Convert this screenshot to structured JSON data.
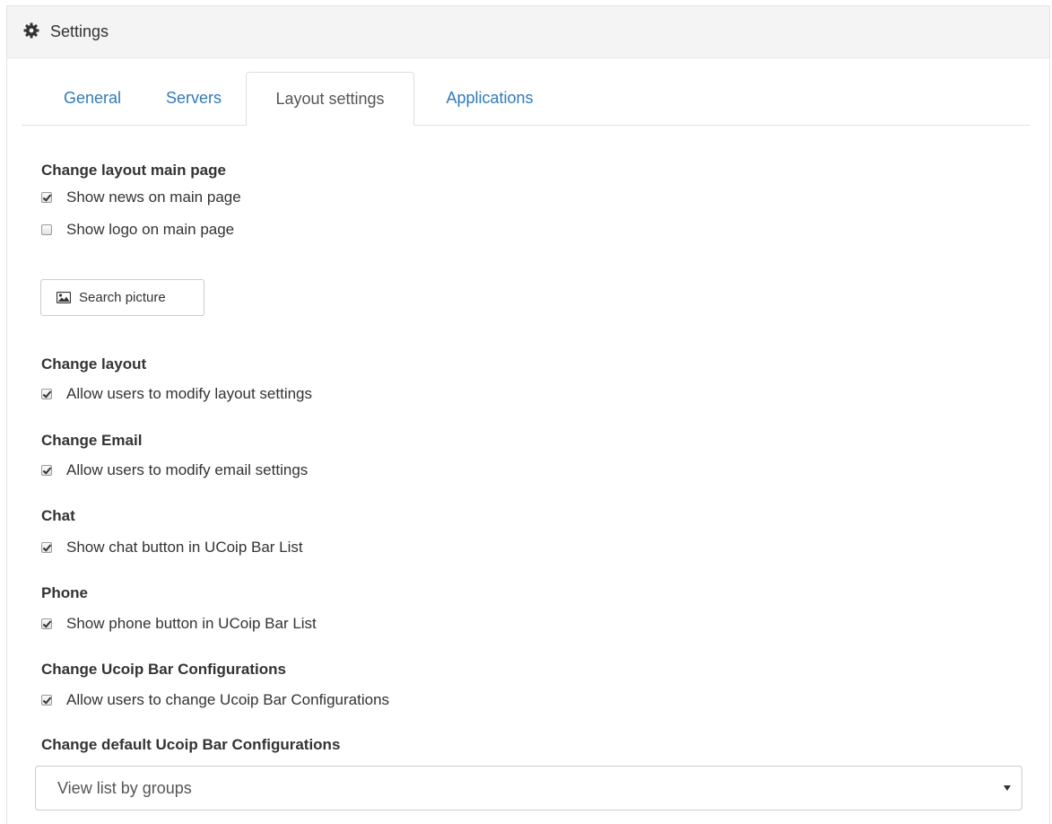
{
  "header": {
    "title": "Settings",
    "icon": "gear-icon"
  },
  "tabs": [
    {
      "label": "General",
      "active": false
    },
    {
      "label": "Servers",
      "active": false
    },
    {
      "label": "Layout settings",
      "active": true
    },
    {
      "label": "Applications",
      "active": false
    }
  ],
  "sections": {
    "main_page": {
      "title": "Change layout main page",
      "options": [
        {
          "label": "Show news on main page",
          "checked": true
        },
        {
          "label": "Show logo on main page",
          "checked": false
        }
      ],
      "button_label": "Search picture",
      "button_icon": "picture-icon"
    },
    "layout": {
      "title": "Change layout",
      "option": {
        "label": "Allow users to modify layout settings",
        "checked": true
      }
    },
    "email": {
      "title": "Change Email",
      "option": {
        "label": "Allow users to modify email settings",
        "checked": true
      }
    },
    "chat": {
      "title": "Chat",
      "option": {
        "label": "Show chat button in UCoip Bar List",
        "checked": true
      }
    },
    "phone": {
      "title": "Phone",
      "option": {
        "label": "Show phone button in UCoip Bar List",
        "checked": true
      }
    },
    "ucoip_config": {
      "title": "Change Ucoip Bar Configurations",
      "option": {
        "label": "Allow users to change Ucoip Bar Configurations",
        "checked": true
      }
    },
    "default_config": {
      "title": "Change default Ucoip Bar Configurations",
      "select_value": "View list by groups"
    }
  },
  "colors": {
    "link": "#337ab7",
    "header_bg": "#f4f4f4",
    "border": "#dddddd"
  }
}
